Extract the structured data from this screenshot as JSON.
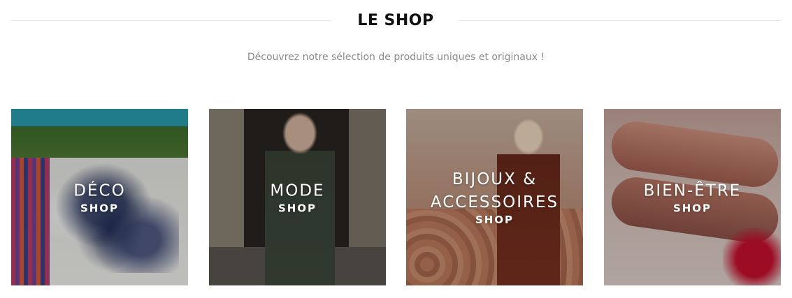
{
  "header": {
    "title": "LE SHOP"
  },
  "subtitle": "Découvrez notre sélection de produits uniques et originaux !",
  "categories": [
    {
      "name": "DÉCO",
      "tag": "SHOP"
    },
    {
      "name": "MODE",
      "tag": "SHOP"
    },
    {
      "name": "BIJOUX &",
      "name2": "ACCESSOIRES",
      "tag": "SHOP"
    },
    {
      "name": "BIEN-ÊTRE",
      "tag": "SHOP"
    }
  ]
}
